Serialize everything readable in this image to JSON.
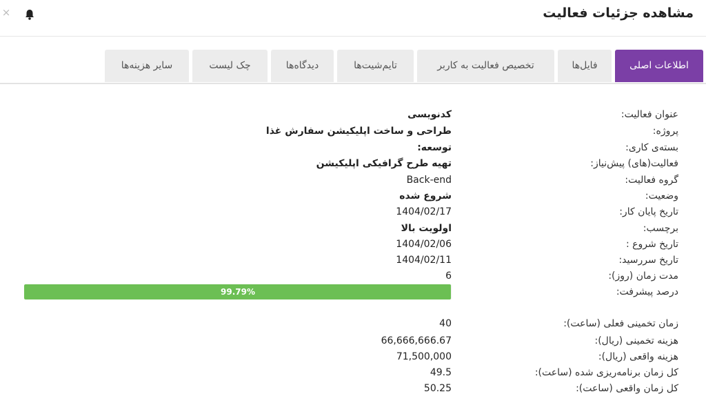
{
  "header": {
    "title": "مشاهده جزئیات فعالیت",
    "close_glyph": "×",
    "icons": [
      "close-icon",
      "bell-icon"
    ]
  },
  "tabs": [
    {
      "label": "اطلاعات اصلی",
      "active": true
    },
    {
      "label": "فایل‌ها",
      "active": false
    },
    {
      "label": "تخصیص فعالیت به کاربر",
      "active": false
    },
    {
      "label": "تایم‌شیت‌ها",
      "active": false
    },
    {
      "label": "دیدگاه‌ها",
      "active": false
    },
    {
      "label": "چک لیست",
      "active": false
    },
    {
      "label": "سایر هزینه‌ها",
      "active": false
    }
  ],
  "details": {
    "title": {
      "label": "عنوان فعالیت:",
      "value": "کدنویسی"
    },
    "project": {
      "label": "پروژه:",
      "value": "طراحی و ساخت اپلیکیشن سفارش غذا"
    },
    "work_package": {
      "label": "بسته‌ی کاری:",
      "value": "توسعه:"
    },
    "prerequisites": {
      "label": "فعالیت(های) پیش‌نیاز:",
      "value": "تهیه طرح گرافیکی اپلیکیشن"
    },
    "group": {
      "label": "گروه فعالیت:",
      "value": "Back-end"
    },
    "status": {
      "label": "وضعیت:",
      "value": "شروع شده"
    },
    "end_date": {
      "label": "تاریخ پایان کار:",
      "value": "1404/02/17"
    },
    "tag": {
      "label": "برچسب:",
      "value": "اولویت بالا"
    },
    "start_date": {
      "label": "تاریخ شروع :",
      "value": "1404/02/06"
    },
    "due_date": {
      "label": "تاریخ سررسید:",
      "value": "1404/02/11"
    },
    "duration": {
      "label": "مدت زمان (روز):",
      "value": "6"
    },
    "progress": {
      "label": "درصد پیشرفت:",
      "value": "99.79%",
      "fraction": 0.9979
    }
  },
  "costs": {
    "estimated_time": {
      "label": "زمان تخمینی فعلی (ساعت):",
      "value": "40"
    },
    "estimated_cost": {
      "label": "هزینه تخمینی (ریال):",
      "value": "66,666,666.67"
    },
    "actual_cost": {
      "label": "هزینه واقعی (ریال):",
      "value": "71,500,000"
    },
    "planned_time": {
      "label": "کل زمان برنامه‌ریزی شده (ساعت):",
      "value": "49.5"
    },
    "actual_time": {
      "label": "کل زمان واقعی (ساعت):",
      "value": "50.25"
    }
  },
  "colors": {
    "accent": "#7b3fa6",
    "progress": "#6cbf54",
    "tab_inactive": "#ececec"
  }
}
